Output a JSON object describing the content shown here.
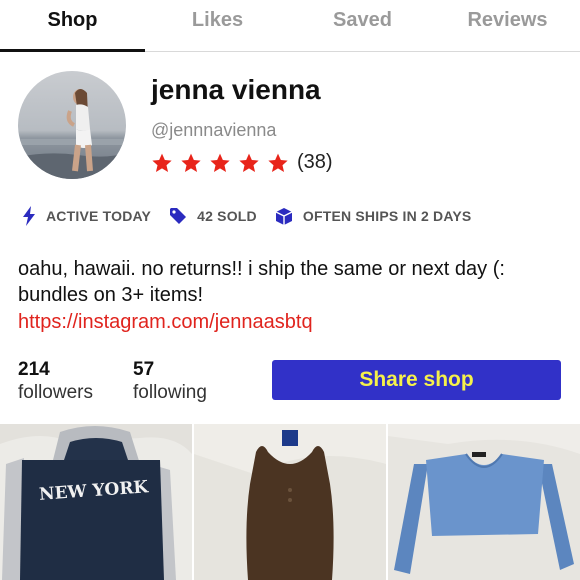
{
  "tabs": [
    {
      "label": "Shop",
      "active": true
    },
    {
      "label": "Likes",
      "active": false
    },
    {
      "label": "Saved",
      "active": false
    },
    {
      "label": "Reviews",
      "active": false
    }
  ],
  "profile": {
    "name": "jenna vienna",
    "handle": "@jennnavienna",
    "rating_stars": 5,
    "rating_count": "(38)",
    "star_color": "#e8241a"
  },
  "stats": [
    {
      "icon": "lightning-icon",
      "label": "ACTIVE TODAY"
    },
    {
      "icon": "tag-icon",
      "label": "42 SOLD"
    },
    {
      "icon": "box-icon",
      "label": "OFTEN SHIPS IN 2 DAYS"
    }
  ],
  "accent_icon_color": "#2b2bbf",
  "bio": "oahu, hawaii. no returns!! i ship the same or next day (: bundles on 3+ items!",
  "link": "https://instagram.com/jennaasbtq",
  "followers": {
    "count": "214",
    "label": "followers"
  },
  "following": {
    "count": "57",
    "label": "following"
  },
  "share_button": {
    "label": "Share shop",
    "bg": "#3131c8",
    "color": "#f5f14a"
  },
  "listings": [
    {
      "description": "navy hoodie",
      "graphic_text": "NEW YORK"
    },
    {
      "description": "brown ribbed tank top"
    },
    {
      "description": "blue cropped sweater"
    }
  ]
}
